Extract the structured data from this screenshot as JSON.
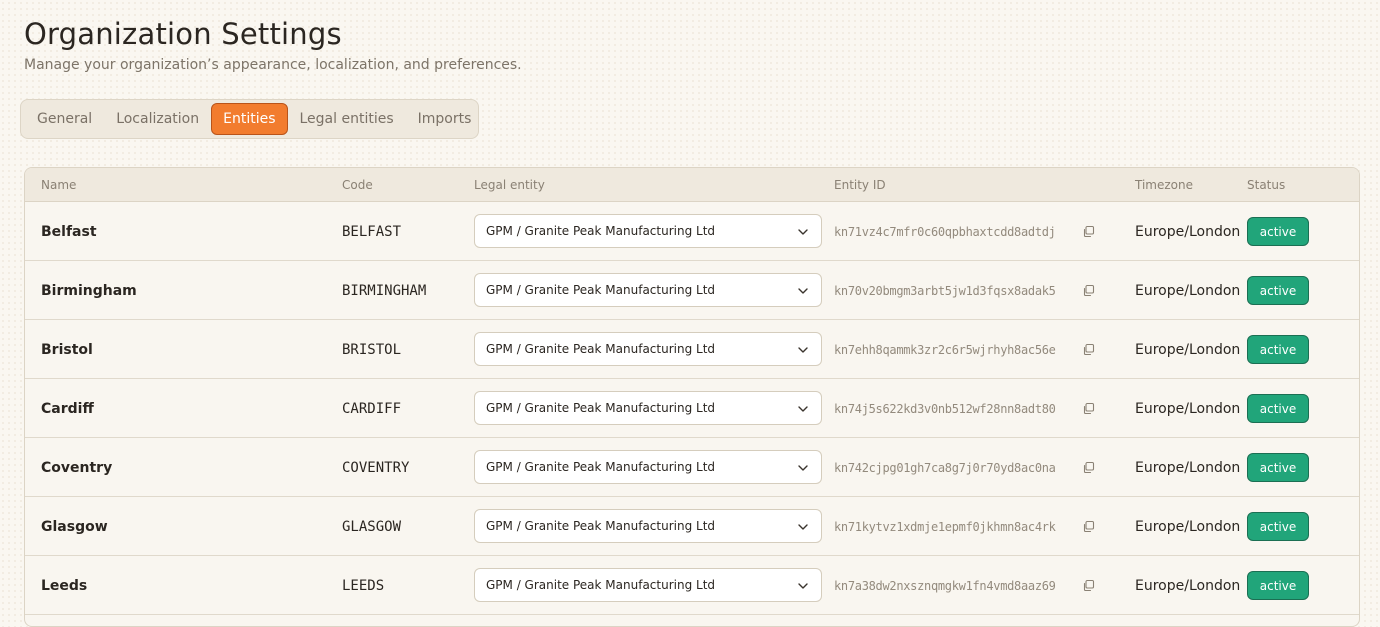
{
  "page": {
    "title": "Organization Settings",
    "subtitle": "Manage your organization’s appearance, localization, and preferences."
  },
  "tabs": [
    {
      "label": "General",
      "active": false
    },
    {
      "label": "Localization",
      "active": false
    },
    {
      "label": "Entities",
      "active": true
    },
    {
      "label": "Legal entities",
      "active": false
    },
    {
      "label": "Imports",
      "active": false
    }
  ],
  "table": {
    "columns": {
      "name": "Name",
      "code": "Code",
      "legal_entity": "Legal entity",
      "entity_id": "Entity ID",
      "timezone": "Timezone",
      "status": "Status"
    },
    "rows": [
      {
        "name": "Belfast",
        "code": "BELFAST",
        "legal_entity": "GPM / Granite Peak Manufacturing Ltd",
        "entity_id": "kn71vz4c7mfr0c60qpbhaxtcdd8adtdj",
        "timezone": "Europe/London",
        "status": "active"
      },
      {
        "name": "Birmingham",
        "code": "BIRMINGHAM",
        "legal_entity": "GPM / Granite Peak Manufacturing Ltd",
        "entity_id": "kn70v20bmgm3arbt5jw1d3fqsx8adak5",
        "timezone": "Europe/London",
        "status": "active"
      },
      {
        "name": "Bristol",
        "code": "BRISTOL",
        "legal_entity": "GPM / Granite Peak Manufacturing Ltd",
        "entity_id": "kn7ehh8qammk3zr2c6r5wjrhyh8ac56e",
        "timezone": "Europe/London",
        "status": "active"
      },
      {
        "name": "Cardiff",
        "code": "CARDIFF",
        "legal_entity": "GPM / Granite Peak Manufacturing Ltd",
        "entity_id": "kn74j5s622kd3v0nb512wf28nn8adt80",
        "timezone": "Europe/London",
        "status": "active"
      },
      {
        "name": "Coventry",
        "code": "COVENTRY",
        "legal_entity": "GPM / Granite Peak Manufacturing Ltd",
        "entity_id": "kn742cjpg01gh7ca8g7j0r70yd8ac0na",
        "timezone": "Europe/London",
        "status": "active"
      },
      {
        "name": "Glasgow",
        "code": "GLASGOW",
        "legal_entity": "GPM / Granite Peak Manufacturing Ltd",
        "entity_id": "kn71kytvz1xdmje1epmf0jkhmn8ac4rk",
        "timezone": "Europe/London",
        "status": "active"
      },
      {
        "name": "Leeds",
        "code": "LEEDS",
        "legal_entity": "GPM / Granite Peak Manufacturing Ltd",
        "entity_id": "kn7a38dw2nxsznqmgkw1fn4vmd8aaz69",
        "timezone": "Europe/London",
        "status": "active"
      }
    ]
  },
  "icons": {
    "select": "chevron-down-icon",
    "copy": "copy-icon"
  },
  "colors": {
    "accent": "#f27c2e",
    "status_active": "#21a57a",
    "background": "#faf7f1"
  }
}
